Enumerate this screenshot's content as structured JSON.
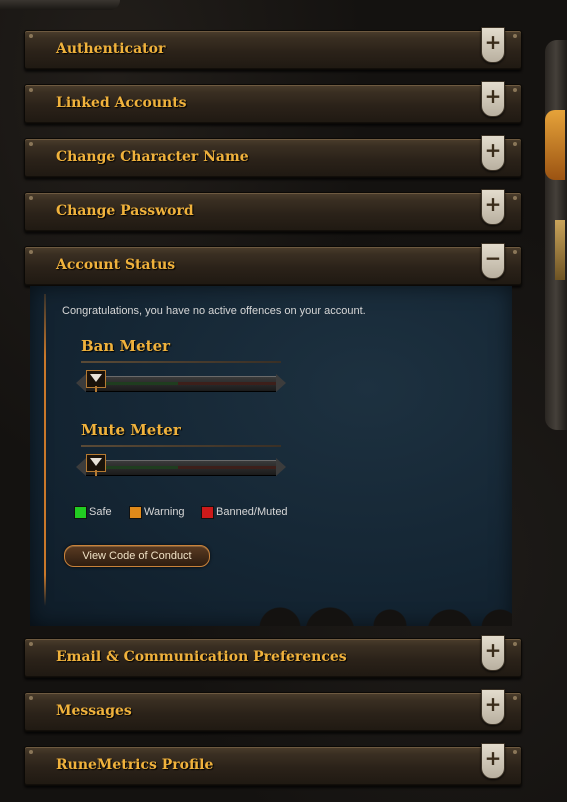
{
  "sections": {
    "authenticator": {
      "title": "Authenticator",
      "toggle": "+"
    },
    "linked_accounts": {
      "title": "Linked Accounts",
      "toggle": "+"
    },
    "change_name": {
      "title": "Change Character Name",
      "toggle": "+"
    },
    "change_password": {
      "title": "Change Password",
      "toggle": "+"
    },
    "account_status": {
      "title": "Account Status",
      "toggle": "−"
    },
    "email_prefs": {
      "title": "Email & Communication Preferences",
      "toggle": "+"
    },
    "messages": {
      "title": "Messages",
      "toggle": "+"
    },
    "runemetrics": {
      "title": "RuneMetrics Profile",
      "toggle": "+"
    }
  },
  "account_status": {
    "notice": "Congratulations, you have no active offences on your account.",
    "ban_meter": {
      "title": "Ban Meter",
      "level": 0
    },
    "mute_meter": {
      "title": "Mute Meter",
      "level": 0
    },
    "legend": [
      {
        "label": "Safe",
        "color": "#22cc22"
      },
      {
        "label": "Warning",
        "color": "#e08a1a"
      },
      {
        "label": "Banned/Muted",
        "color": "#cc1a1a"
      }
    ],
    "conduct_button": "View Code of Conduct"
  },
  "colors": {
    "title_gold": "#f0b23c",
    "panel_blue": "#142533",
    "bar_brown": "#2b2219"
  }
}
